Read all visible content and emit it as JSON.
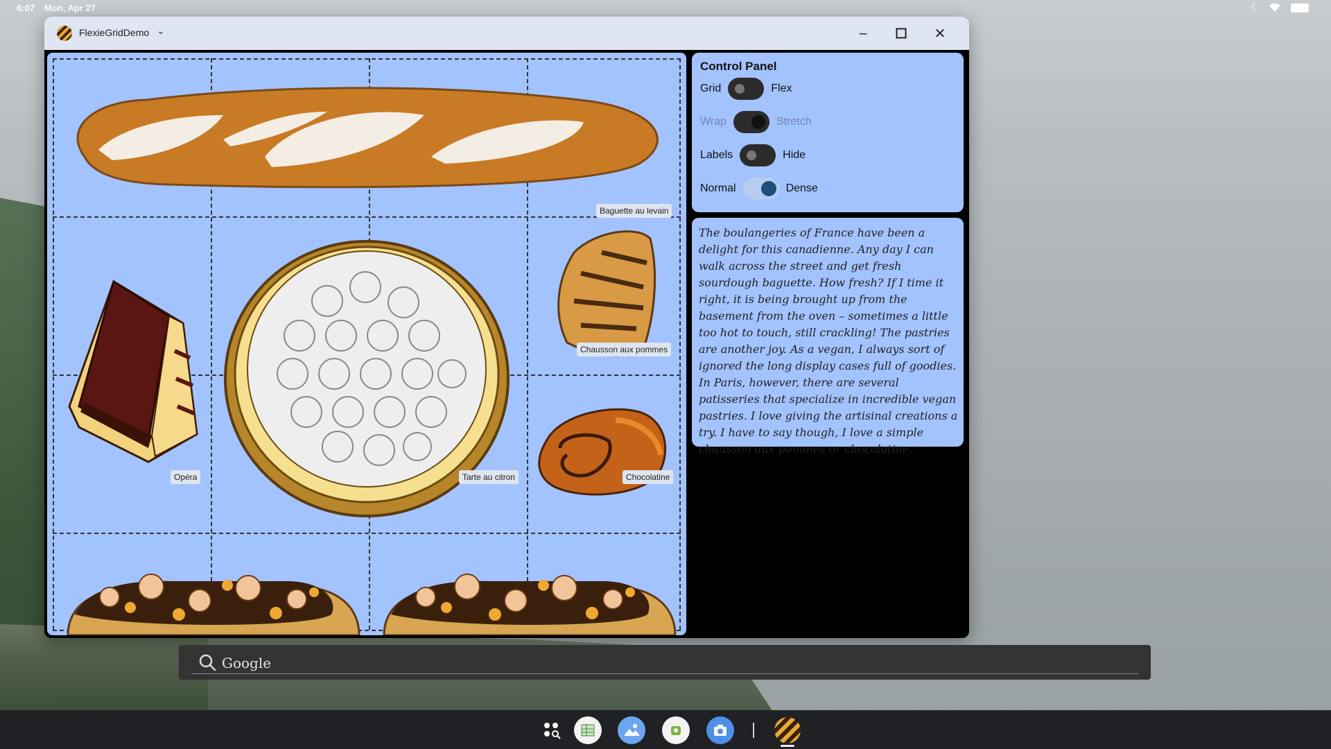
{
  "status_bar": {
    "time": "6:07",
    "date": "Mon, Apr 27",
    "icons": [
      "do-not-disturb-icon",
      "wifi-icon",
      "battery-icon"
    ]
  },
  "window": {
    "title": "FlexieGridDemo",
    "controls": [
      "minimize-icon",
      "maximize-icon",
      "close-icon"
    ]
  },
  "grid": {
    "items": [
      {
        "label": "Baguette au levain"
      },
      {
        "label": "Opéra"
      },
      {
        "label": "Tarte au citron"
      },
      {
        "label": "Chausson aux pommes"
      },
      {
        "label": "Chocolatine"
      },
      {
        "label": ""
      },
      {
        "label": ""
      }
    ]
  },
  "control_panel": {
    "title": "Control Panel",
    "rows": [
      {
        "left": "Grid",
        "right": "Flex",
        "state": "off"
      },
      {
        "left": "Wrap",
        "right": "Stretch",
        "state": "on",
        "disabled": true
      },
      {
        "left": "Labels",
        "right": "Hide",
        "state": "off"
      },
      {
        "left": "Normal",
        "right": "Dense",
        "state": "on"
      }
    ]
  },
  "story": {
    "text": "The boulangeries of France have been a delight for this canadienne. Any day I can walk across the street and get fresh sourdough baguette. How fresh? If I time it right, it is being brought up from the basement from the oven – sometimes a little too hot to touch, still crackling! The pastries are another joy. As a vegan, I always sort of ignored the long display cases full of goodies. In Paris, however, there are several patisseries that specialize in incredible vegan pastries. I love giving the artisinal creations a try. I have to say though, I love a simple chausson aux pommes or chocolatine."
  },
  "search": {
    "placeholder": "Google"
  },
  "taskbar": {
    "apps": [
      "launcher-icon",
      "sheets-icon",
      "photos-icon",
      "android-studio-icon",
      "camera-icon",
      "flexiegriddemo-icon"
    ]
  },
  "colors": {
    "panel_bg": "#a3c3ff",
    "window_bg": "#000000",
    "titlebar_bg": "#dfe6f2"
  }
}
